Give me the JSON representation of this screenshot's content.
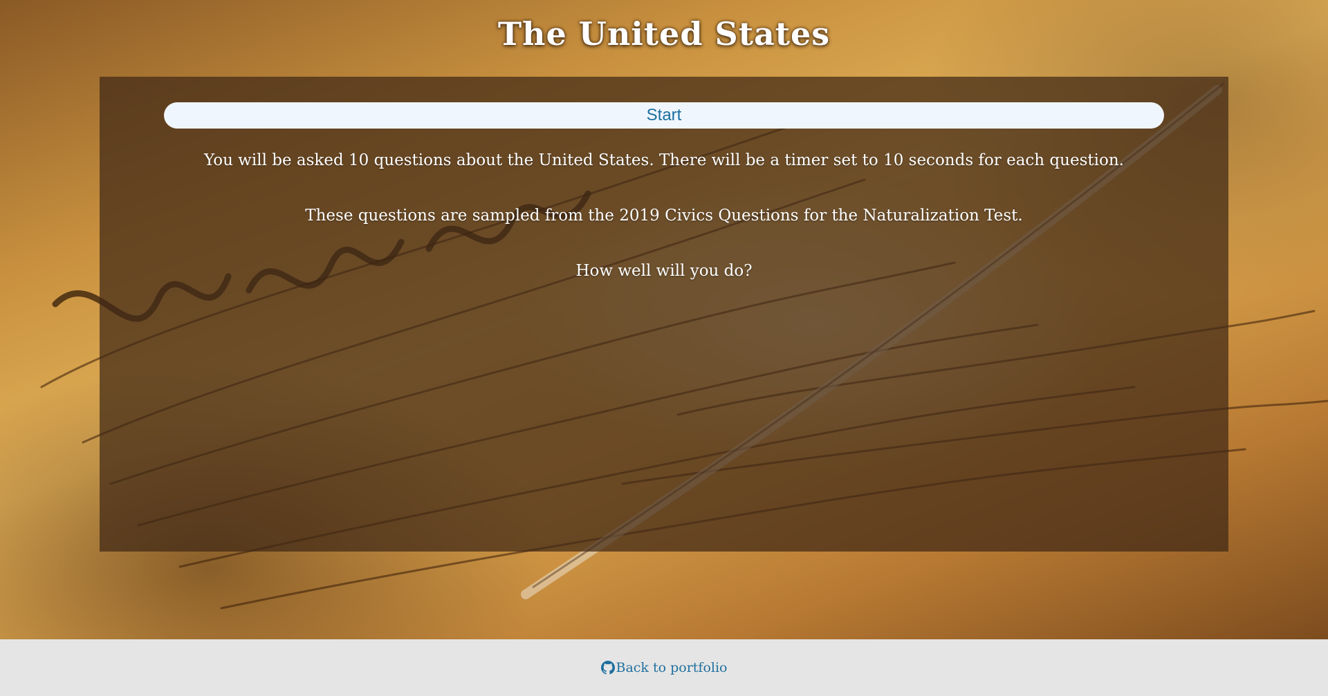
{
  "page": {
    "title": "The United States"
  },
  "quiz": {
    "start_label": "Start",
    "intro_line_1": "You will be asked 10 questions about the United States. There will be a timer set to 10 seconds for each question.",
    "intro_line_2": "These questions are sampled from the 2019 Civics Questions for the Naturalization Test.",
    "intro_line_3": "How well will you do?"
  },
  "footer": {
    "link_label": "Back to portfolio",
    "icon": "github-icon"
  },
  "colors": {
    "link": "#1f6f9e",
    "button_bg": "#f0f6fd",
    "panel_overlay": "rgba(64,40,22,0.72)"
  }
}
